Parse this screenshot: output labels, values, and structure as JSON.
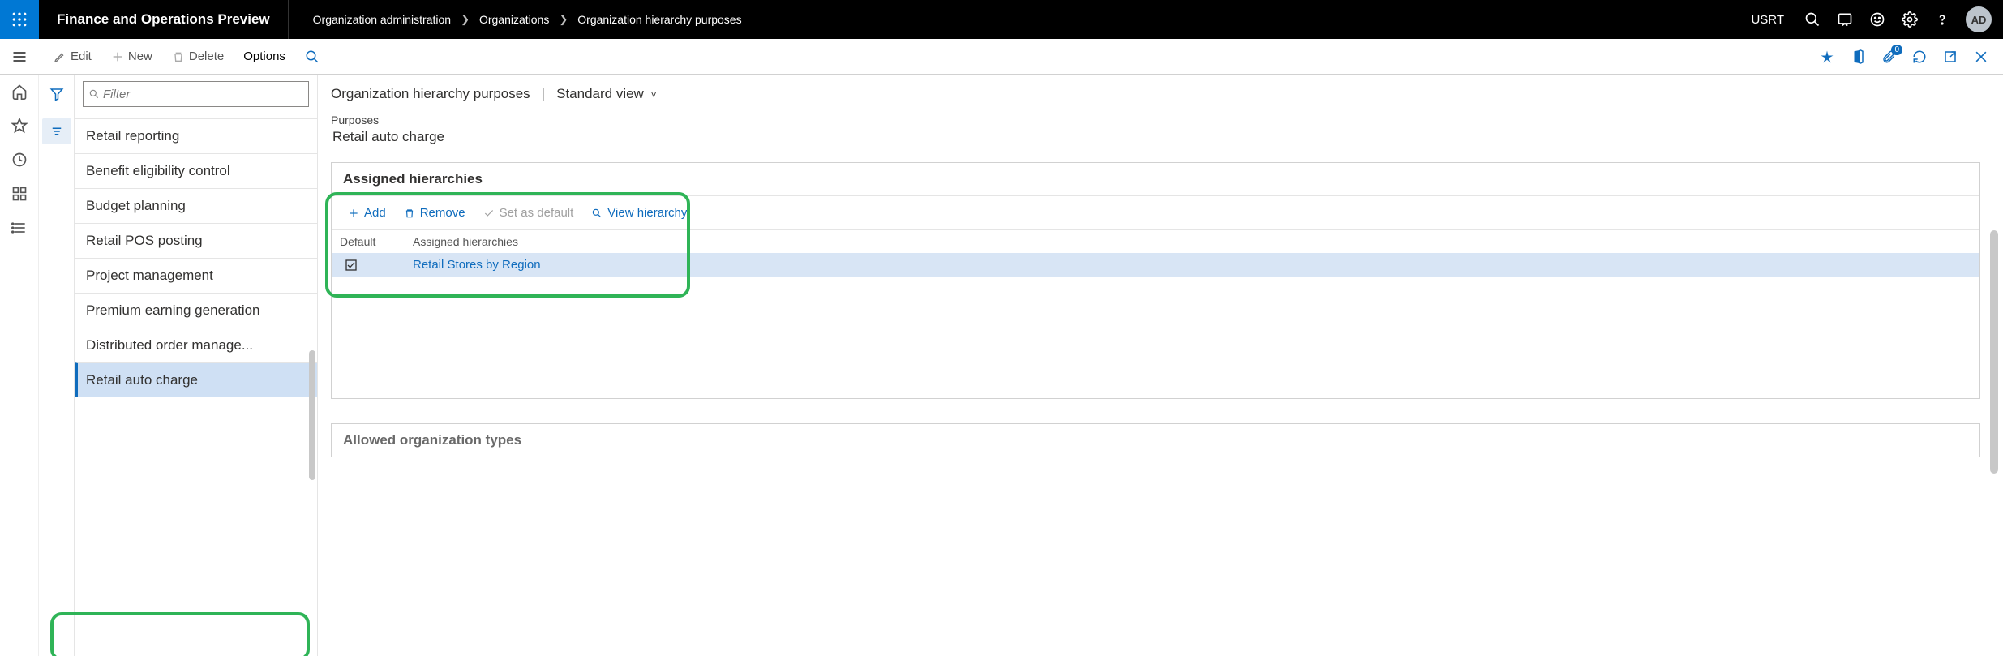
{
  "header": {
    "app_title": "Finance and Operations Preview",
    "breadcrumb": [
      "Organization administration",
      "Organizations",
      "Organization hierarchy purposes"
    ],
    "company": "USRT",
    "avatar": "AD"
  },
  "commandbar": {
    "edit": "Edit",
    "new": "New",
    "delete": "Delete",
    "options": "Options",
    "attachment_count": "0"
  },
  "filter": {
    "placeholder": "Filter"
  },
  "purposes_list": [
    "Retail reporting",
    "Benefit eligibility control",
    "Budget planning",
    "Retail POS posting",
    "Project management",
    "Premium earning generation",
    "Distributed order manage...",
    "Retail auto charge"
  ],
  "selected_purpose_index": 7,
  "main": {
    "page_title": "Organization hierarchy purposes",
    "view_label": "Standard view",
    "purposes_label": "Purposes",
    "purposes_value": "Retail auto charge",
    "assigned_section_title": "Assigned hierarchies",
    "toolbar": {
      "add": "Add",
      "remove": "Remove",
      "set_default": "Set as default",
      "view_hierarchy": "View hierarchy"
    },
    "table": {
      "col_default": "Default",
      "col_assigned": "Assigned hierarchies",
      "rows": [
        {
          "default": true,
          "name": "Retail Stores by Region"
        }
      ]
    },
    "allowed_section_title": "Allowed organization types"
  }
}
